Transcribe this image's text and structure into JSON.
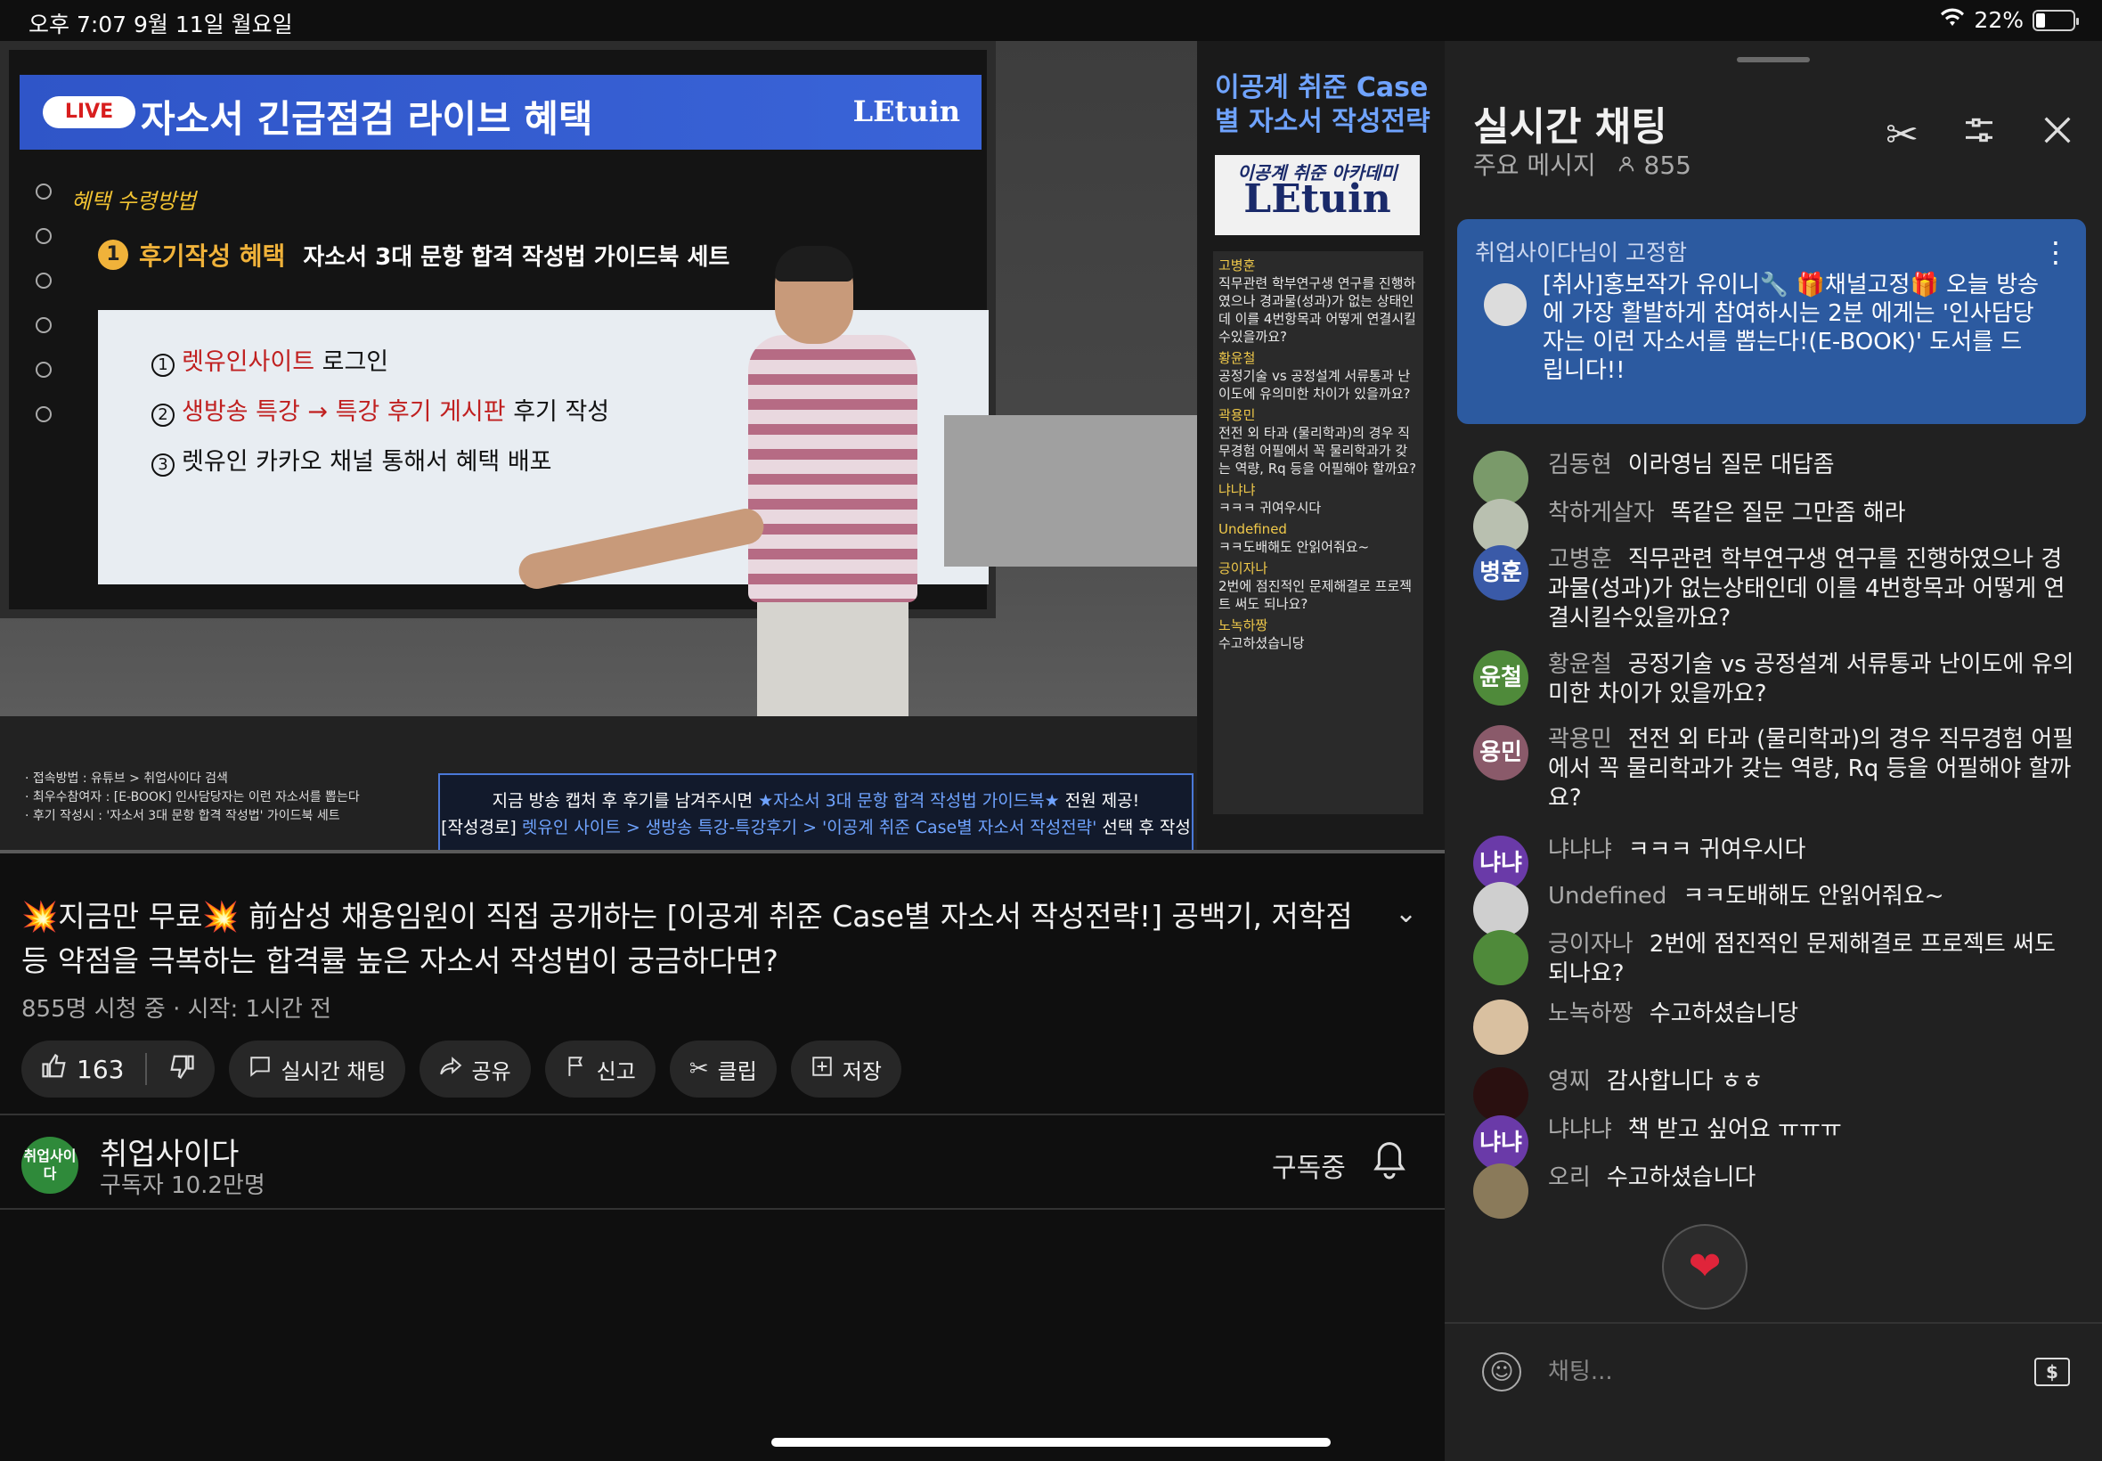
{
  "status": {
    "time": "오후 7:07",
    "date": "9월 11일 월요일",
    "battery": "22%",
    "battery_level": 0.22
  },
  "video": {
    "live_label": "LIVE",
    "banner_title": "자소서 긴급점검 라이브 혜택",
    "banner_logo": "LEtuin",
    "benefit_sub": "혜택 수령방법",
    "step_num": "1",
    "step_title": "후기작성 혜택",
    "step_sub": "자소서 3대 문항 합격 작성법 가이드북 세트",
    "wb_lines": [
      {
        "num": "1",
        "red": "렛유인사이트",
        "rest": " 로그인"
      },
      {
        "num": "2",
        "red": "생방송 특강 → 특강 후기 게시판",
        "rest": " 후기 작성"
      },
      {
        "num": "3",
        "red": "",
        "rest": "렛유인 카카오 채널 통해서 혜택 배포"
      }
    ],
    "rp_title": "이공계 취준 Case별 자소서 작성전략",
    "rp_logo_top": "이공계 취준 아카데미",
    "rp_logo": "LEtuin",
    "rp_chat": [
      {
        "name": "고병훈",
        "text": "직무관련 학부연구생 연구를 진행하였으나 경과물(성과)가 없는 상태인데 이를 4번항목과 어떻게 연결시킬수있을까요?"
      },
      {
        "name": "황윤철",
        "text": "공정기술 vs 공정설계 서류통과 난이도에 유의미한 차이가 있을까요?"
      },
      {
        "name": "곽용민",
        "text": "전전 외 타과 (물리학과)의 경우 직무경험 어필에서 꼭 물리학과가 갖는 역량, Rq 등을 어필해야 할까요?"
      },
      {
        "name": "냐냐냐",
        "text": "ㅋㅋㅋ 귀여우시다"
      },
      {
        "name": "Undefined",
        "text": "ㅋㅋ도배해도 안읽어줘요~"
      },
      {
        "name": "긍이자나",
        "text": "2번에 점진적인 문제해결로 프로젝트 써도 되나요?"
      },
      {
        "name": "노녹하짱",
        "text": "수고하셨습니당"
      }
    ],
    "lower_left": [
      "· 접속방법 : 유튜브 > 취업사이다 검색",
      "· 최우수참여자 : [E-BOOK] 인사담당자는 이런 자소서를 뽑는다",
      "· 후기 작성시 : '자소서 3대 문항 합격 작성법' 가이드북 세트"
    ],
    "notice_line1_a": "지금 방송 캡처 후 후기를 남겨주시면 ",
    "notice_line1_hl": "★자소서 3대 문항 합격 작성법 가이드북★",
    "notice_line1_b": " 전원 제공!",
    "notice_line2_a": "[작성경로] ",
    "notice_line2_hl": "렛유인 사이트 > 생방송 특강-특강후기 > '이공계 취준 Case별 자소서 작성전략'",
    "notice_line2_b": " 선택 후 작성"
  },
  "title": "💥지금만 무료💥 前삼성 채용임원이 직접 공개하는 [이공계 취준 Case별 자소서 작성전략!] 공백기, 저학점 등 약점을 극복하는 합격률 높은 자소서 작성법이 궁금하다면?",
  "meta": "855명 시청 중 · 시작: 1시간 전",
  "actions": {
    "likes": "163",
    "live_chat": "실시간 채팅",
    "share": "공유",
    "report": "신고",
    "clip": "클립",
    "save": "저장"
  },
  "channel": {
    "avatar_text": "취업사이다",
    "name": "취업사이다",
    "subs": "구독자 10.2만명",
    "subscribed": "구독중"
  },
  "chat": {
    "title": "실시간 채팅",
    "subtitle": "주요 메시지",
    "viewers": "855",
    "pinned_by": "취업사이다님이 고정함",
    "pinned_text": "[취사]홍보작가 유이니🔧 🎁채널고정🎁 오늘 방송에 가장 활발하게 참여하시는 2분 에게는 '인사담당자는 이런 자소서를 뽑는다!(E-BOOK)' 도서를 드립니다!!",
    "messages": [
      {
        "author": "김동현",
        "text": "이라영님 질문 대답좀",
        "avatar": "",
        "color": "#7a9a6a"
      },
      {
        "author": "착하게살자",
        "text": "똑같은 질문 그만좀 해라",
        "avatar": "",
        "color": "#b9c0b0"
      },
      {
        "author": "고병훈",
        "text": "직무관련 학부연구생 연구를 진행하였으나 경과물(성과)가 없는상태인데 이를 4번항목과 어떻게 연결시킬수있을까요?",
        "avatar": "병훈",
        "color": "#3a5aa8"
      },
      {
        "author": "황윤철",
        "text": "공정기술 vs 공정설계 서류통과 난이도에 유의미한 차이가 있을까요?",
        "avatar": "윤철",
        "color": "#4f8a3a"
      },
      {
        "author": "곽용민",
        "text": "전전 외 타과 (물리학과)의 경우 직무경험 어필에서 꼭 물리학과가 갖는 역량, Rq 등을 어필해야 할까요?",
        "avatar": "용민",
        "color": "#8a5a6a"
      },
      {
        "author": "냐냐냐",
        "text": "ㅋㅋㅋ 귀여우시다",
        "avatar": "냐냐",
        "color": "#6a3aa8"
      },
      {
        "author": "Undefined",
        "text": "ㅋㅋ도배해도 안읽어줘요~",
        "avatar": "",
        "color": "#cfcfcf"
      },
      {
        "author": "긍이자나",
        "text": "2번에 점진적인 문제해결로 프로젝트 써도 되나요?",
        "avatar": "",
        "color": "#4f8a3a"
      },
      {
        "author": "노녹하짱",
        "text": "수고하셨습니당",
        "avatar": "",
        "color": "#d9c0a0"
      },
      {
        "author": "영찌",
        "text": "감사합니다 ㅎㅎ",
        "avatar": "",
        "color": "#2a1010"
      },
      {
        "author": "냐냐냐",
        "text": "책 받고 싶어요 ㅠㅠㅠ",
        "avatar": "냐냐",
        "color": "#6a3aa8"
      },
      {
        "author": "오리",
        "text": "수고하셨습니다",
        "avatar": "",
        "color": "#8a7a5a"
      }
    ],
    "input_placeholder": "채팅...",
    "superchat": "$"
  }
}
